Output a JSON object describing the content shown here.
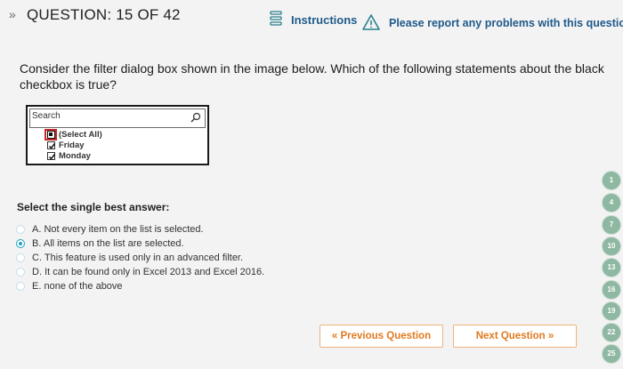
{
  "header": {
    "arrow": "»",
    "question_counter": "QUESTION: 15 OF 42",
    "instructions_label": "Instructions",
    "report_label": "Please report any problems with this question."
  },
  "question": {
    "text": "Consider the filter dialog box shown in the image below. Which of the following statements about the black checkbox is true?"
  },
  "filter_dialog": {
    "search_placeholder": "Search",
    "items": [
      {
        "label": "(Select All)",
        "state": "black-box"
      },
      {
        "label": "Friday",
        "state": "checked"
      },
      {
        "label": "Monday",
        "state": "checked"
      }
    ]
  },
  "answers": {
    "title": "Select the single best answer:",
    "options": [
      {
        "letter": "A.",
        "text": "Not every item on the list is selected.",
        "selected": false
      },
      {
        "letter": "B.",
        "text": "All items on the list are selected.",
        "selected": true
      },
      {
        "letter": "C.",
        "text": "This feature is used only in an advanced filter.",
        "selected": false
      },
      {
        "letter": "D.",
        "text": "It can be found only in Excel 2013 and Excel 2016.",
        "selected": false
      },
      {
        "letter": "E.",
        "text": "none of the above",
        "selected": false
      }
    ]
  },
  "navigation": {
    "prev_label": "« Previous Question",
    "next_label": "Next Question »"
  },
  "side_badges": [
    "1",
    "4",
    "7",
    "10",
    "13",
    "16",
    "19",
    "22",
    "25"
  ],
  "colors": {
    "link": "#1f5a8a",
    "accent_orange": "#e07a20",
    "radio_selected": "#1ea3c3",
    "highlight_red": "#c62828",
    "badge_green": "#8fb8a2"
  }
}
